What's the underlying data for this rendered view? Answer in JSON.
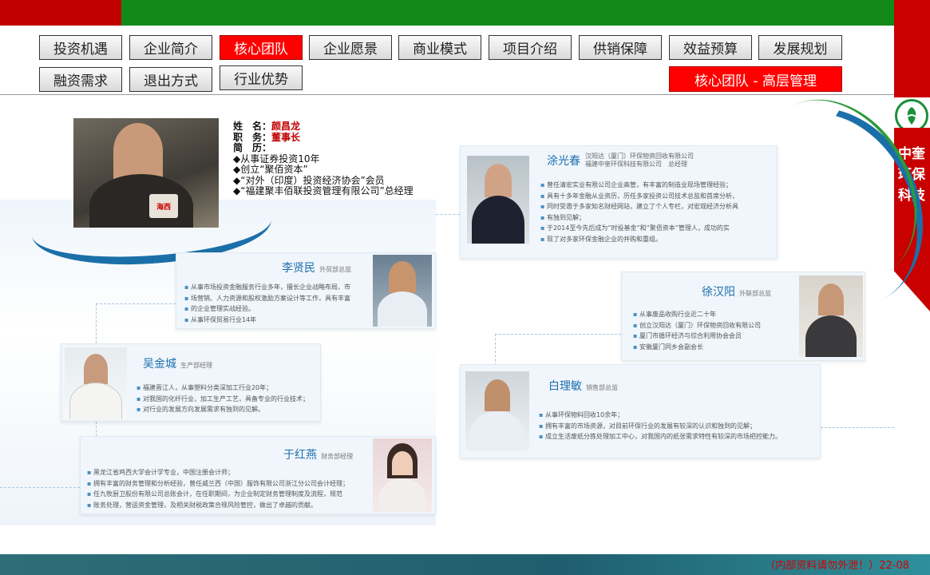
{
  "nav": {
    "row1": [
      "投资机遇",
      "企业简介",
      "核心团队",
      "企业愿景",
      "商业模式",
      "项目介绍",
      "供销保障",
      "效益预算",
      "发展规划"
    ],
    "row2": [
      "融资需求",
      "退出方式",
      "行业优势"
    ],
    "active": "核心团队"
  },
  "banner": "核心团队 - 高层管理",
  "side": {
    "brand": "中奎环保科技"
  },
  "colors": {
    "accent_red": "#ff0000",
    "top_green": "#118a1a",
    "brand_red": "#c80000"
  },
  "chairman": {
    "name_label": "姓　名：",
    "name": "颜昌龙",
    "title_label": "职　务：",
    "title": "董事长",
    "resume_label": "简　历：",
    "items": [
      "◆从事证券投资10年",
      "◆创立“聚佰资本”",
      "◆“对外（印度）投资经济协会”会员",
      "◆“福建聚丰佰联投资管理有限公司”总经理"
    ],
    "mic_text": "海西"
  },
  "members": [
    {
      "name": "涂光春",
      "role": "",
      "org": [
        "汉阳达（厦门）环保物资回收有限公司",
        "福建中奎环保科技有限公司　总经理"
      ],
      "items": [
        "曾任清宏实业有限公司企业高管，有丰富的制造业现场管理经验；",
        "具有十多年金融从业资历，历任多家投资公司技术总监和首席分析，",
        "同时受邀于多家知名财经网站，建立了个人专栏，对宏观经济分析具",
        "有独到见解；",
        "于2014至今先后成为“时投基金”和“聚佰资本”管理人，成功的实",
        "现了对多家环保金融企业的并购和重组。"
      ]
    },
    {
      "name": "李贤民",
      "role": "外贸部总监",
      "items": [
        "从事市场投资金融服务行业多年，擅长企业战略布局、市",
        "场营销、人力资源和股权激励方案设计等工作，具有丰富",
        "的企业管理实战经验。",
        "从事环保贸易行业14年"
      ]
    },
    {
      "name": "徐汉阳",
      "role": "外联部总监",
      "items": [
        "从事废品收购行业近二十年",
        "创立汉阳达（厦门）环保物资回收有限公司",
        "厦门市循环经济与综合利用协会会员",
        "安徽厦门同乡会副会长"
      ]
    },
    {
      "name": "吴金城",
      "role": "生产部经理",
      "items": [
        "福建晋江人，从事塑料分类深加工行业20年；",
        "对我国的化纤行业，加工生产工艺，具备专业的行业技术；",
        "对行业的发展方向发展需求有独到的见解。"
      ]
    },
    {
      "name": "白理敏",
      "role": "销售部总监",
      "items": [
        "从事环保物料回收10余年；",
        "拥有丰富的市场资源，对目前环保行业的发展有较深的认识和独到的见解；",
        "成立生活废纸分拣处理加工中心，对我国内的纸张需求特性有较深的市场把控能力。"
      ]
    },
    {
      "name": "于红燕",
      "role": "财务部经理",
      "items": [
        "黑龙江省鸡西大学会计学专业，中国注册会计师；",
        "拥有丰富的财务管理和分析经验，曾任威兰西（中国）服饰有限公司浙江分公司会计经理；",
        "任九牧厨卫股份有限公司总账会计，在任职期间，为企业制定财务管理制度及流程，规范",
        "账务处理，营运资金管理，及相关财税政策合规风险管控，做出了卓越的贡献。"
      ]
    }
  ],
  "footer": "（内部资料请勿外泄！）22-08"
}
